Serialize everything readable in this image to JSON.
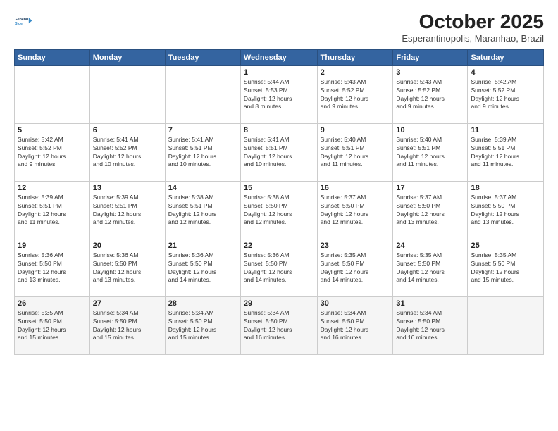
{
  "header": {
    "logo_line1": "General",
    "logo_line2": "Blue",
    "month": "October 2025",
    "location": "Esperantinopolis, Maranhao, Brazil"
  },
  "days_of_week": [
    "Sunday",
    "Monday",
    "Tuesday",
    "Wednesday",
    "Thursday",
    "Friday",
    "Saturday"
  ],
  "weeks": [
    [
      {
        "day": "",
        "info": ""
      },
      {
        "day": "",
        "info": ""
      },
      {
        "day": "",
        "info": ""
      },
      {
        "day": "1",
        "info": "Sunrise: 5:44 AM\nSunset: 5:53 PM\nDaylight: 12 hours\nand 8 minutes."
      },
      {
        "day": "2",
        "info": "Sunrise: 5:43 AM\nSunset: 5:52 PM\nDaylight: 12 hours\nand 9 minutes."
      },
      {
        "day": "3",
        "info": "Sunrise: 5:43 AM\nSunset: 5:52 PM\nDaylight: 12 hours\nand 9 minutes."
      },
      {
        "day": "4",
        "info": "Sunrise: 5:42 AM\nSunset: 5:52 PM\nDaylight: 12 hours\nand 9 minutes."
      }
    ],
    [
      {
        "day": "5",
        "info": "Sunrise: 5:42 AM\nSunset: 5:52 PM\nDaylight: 12 hours\nand 9 minutes."
      },
      {
        "day": "6",
        "info": "Sunrise: 5:41 AM\nSunset: 5:52 PM\nDaylight: 12 hours\nand 10 minutes."
      },
      {
        "day": "7",
        "info": "Sunrise: 5:41 AM\nSunset: 5:51 PM\nDaylight: 12 hours\nand 10 minutes."
      },
      {
        "day": "8",
        "info": "Sunrise: 5:41 AM\nSunset: 5:51 PM\nDaylight: 12 hours\nand 10 minutes."
      },
      {
        "day": "9",
        "info": "Sunrise: 5:40 AM\nSunset: 5:51 PM\nDaylight: 12 hours\nand 11 minutes."
      },
      {
        "day": "10",
        "info": "Sunrise: 5:40 AM\nSunset: 5:51 PM\nDaylight: 12 hours\nand 11 minutes."
      },
      {
        "day": "11",
        "info": "Sunrise: 5:39 AM\nSunset: 5:51 PM\nDaylight: 12 hours\nand 11 minutes."
      }
    ],
    [
      {
        "day": "12",
        "info": "Sunrise: 5:39 AM\nSunset: 5:51 PM\nDaylight: 12 hours\nand 11 minutes."
      },
      {
        "day": "13",
        "info": "Sunrise: 5:39 AM\nSunset: 5:51 PM\nDaylight: 12 hours\nand 12 minutes."
      },
      {
        "day": "14",
        "info": "Sunrise: 5:38 AM\nSunset: 5:51 PM\nDaylight: 12 hours\nand 12 minutes."
      },
      {
        "day": "15",
        "info": "Sunrise: 5:38 AM\nSunset: 5:50 PM\nDaylight: 12 hours\nand 12 minutes."
      },
      {
        "day": "16",
        "info": "Sunrise: 5:37 AM\nSunset: 5:50 PM\nDaylight: 12 hours\nand 12 minutes."
      },
      {
        "day": "17",
        "info": "Sunrise: 5:37 AM\nSunset: 5:50 PM\nDaylight: 12 hours\nand 13 minutes."
      },
      {
        "day": "18",
        "info": "Sunrise: 5:37 AM\nSunset: 5:50 PM\nDaylight: 12 hours\nand 13 minutes."
      }
    ],
    [
      {
        "day": "19",
        "info": "Sunrise: 5:36 AM\nSunset: 5:50 PM\nDaylight: 12 hours\nand 13 minutes."
      },
      {
        "day": "20",
        "info": "Sunrise: 5:36 AM\nSunset: 5:50 PM\nDaylight: 12 hours\nand 13 minutes."
      },
      {
        "day": "21",
        "info": "Sunrise: 5:36 AM\nSunset: 5:50 PM\nDaylight: 12 hours\nand 14 minutes."
      },
      {
        "day": "22",
        "info": "Sunrise: 5:36 AM\nSunset: 5:50 PM\nDaylight: 12 hours\nand 14 minutes."
      },
      {
        "day": "23",
        "info": "Sunrise: 5:35 AM\nSunset: 5:50 PM\nDaylight: 12 hours\nand 14 minutes."
      },
      {
        "day": "24",
        "info": "Sunrise: 5:35 AM\nSunset: 5:50 PM\nDaylight: 12 hours\nand 14 minutes."
      },
      {
        "day": "25",
        "info": "Sunrise: 5:35 AM\nSunset: 5:50 PM\nDaylight: 12 hours\nand 15 minutes."
      }
    ],
    [
      {
        "day": "26",
        "info": "Sunrise: 5:35 AM\nSunset: 5:50 PM\nDaylight: 12 hours\nand 15 minutes."
      },
      {
        "day": "27",
        "info": "Sunrise: 5:34 AM\nSunset: 5:50 PM\nDaylight: 12 hours\nand 15 minutes."
      },
      {
        "day": "28",
        "info": "Sunrise: 5:34 AM\nSunset: 5:50 PM\nDaylight: 12 hours\nand 15 minutes."
      },
      {
        "day": "29",
        "info": "Sunrise: 5:34 AM\nSunset: 5:50 PM\nDaylight: 12 hours\nand 16 minutes."
      },
      {
        "day": "30",
        "info": "Sunrise: 5:34 AM\nSunset: 5:50 PM\nDaylight: 12 hours\nand 16 minutes."
      },
      {
        "day": "31",
        "info": "Sunrise: 5:34 AM\nSunset: 5:50 PM\nDaylight: 12 hours\nand 16 minutes."
      },
      {
        "day": "",
        "info": ""
      }
    ]
  ]
}
